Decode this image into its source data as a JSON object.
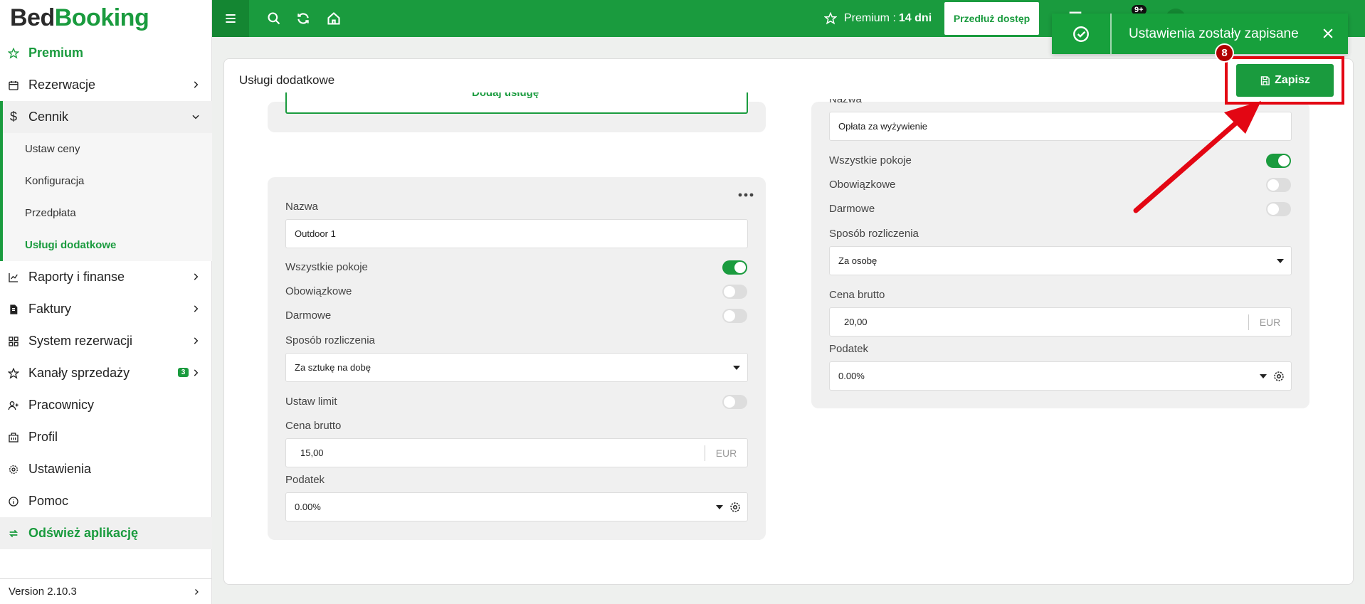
{
  "brand": {
    "part1": "Bed",
    "part2": "Booking"
  },
  "sidebar": {
    "premium": "Premium",
    "items": [
      {
        "label": "Rezerwacje"
      },
      {
        "label": "Cennik"
      },
      {
        "label": "Raporty i finanse"
      },
      {
        "label": "Faktury"
      },
      {
        "label": "System rezerwacji"
      },
      {
        "label": "Kanały sprzedaży",
        "badge": "3"
      },
      {
        "label": "Pracownicy"
      },
      {
        "label": "Profil"
      },
      {
        "label": "Ustawienia"
      },
      {
        "label": "Pomoc"
      }
    ],
    "sub_items": [
      {
        "label": "Ustaw ceny"
      },
      {
        "label": "Konfiguracja"
      },
      {
        "label": "Przedpłata"
      },
      {
        "label": "Usługi dodatkowe"
      }
    ],
    "refresh": "Odśwież aplikację",
    "version": "Version 2.10.3"
  },
  "topbar": {
    "premium_label": "Premium : ",
    "premium_days": "14 dni",
    "extend_button": "Przedłuż dostęp",
    "notif_count": "9+"
  },
  "toast": {
    "message": "Ustawienia zostały zapisane"
  },
  "page": {
    "title": "Usługi dodatkowe",
    "save_button": "Zapisz",
    "step": "8",
    "add_service": "Dodaj usługę"
  },
  "left_service": {
    "name_label": "Nazwa",
    "name_value": "Outdoor 1",
    "all_rooms_label": "Wszystkie pokoje",
    "all_rooms": true,
    "mandatory_label": "Obowiązkowe",
    "mandatory": false,
    "free_label": "Darmowe",
    "free": false,
    "billing_label": "Sposób rozliczenia",
    "billing_value": "Za sztukę na dobę",
    "limit_label": "Ustaw limit",
    "limit": false,
    "price_label": "Cena brutto",
    "price_value": "15,00",
    "currency": "EUR",
    "tax_label": "Podatek",
    "tax_value": "0.00%"
  },
  "right_service": {
    "name_label": "Nazwa",
    "name_value": "Opłata za wyżywienie",
    "all_rooms_label": "Wszystkie pokoje",
    "all_rooms": true,
    "mandatory_label": "Obowiązkowe",
    "mandatory": false,
    "free_label": "Darmowe",
    "free": false,
    "billing_label": "Sposób rozliczenia",
    "billing_value": "Za osobę",
    "price_label": "Cena brutto",
    "price_value": "20,00",
    "currency": "EUR",
    "tax_label": "Podatek",
    "tax_value": "0.00%"
  },
  "colors": {
    "brand_green": "#1a9b3e",
    "annotation_red": "#e30613"
  }
}
